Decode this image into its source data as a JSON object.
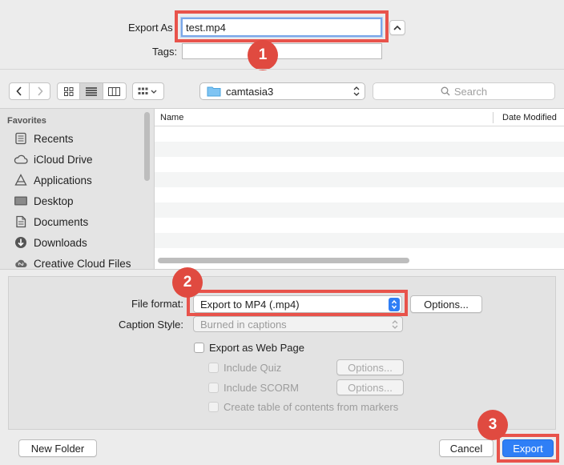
{
  "export_row": {
    "export_as_label": "Export As",
    "filename": "test.mp4",
    "tags_label": "Tags:",
    "tags_value": ""
  },
  "toolbar": {
    "location": "camtasia3",
    "search_placeholder": "Search"
  },
  "sidebar": {
    "heading": "Favorites",
    "items": [
      {
        "label": "Recents",
        "icon": "recents-icon"
      },
      {
        "label": "iCloud Drive",
        "icon": "cloud-icon"
      },
      {
        "label": "Applications",
        "icon": "applications-icon"
      },
      {
        "label": "Desktop",
        "icon": "desktop-icon"
      },
      {
        "label": "Documents",
        "icon": "documents-icon"
      },
      {
        "label": "Downloads",
        "icon": "downloads-icon"
      },
      {
        "label": "Creative Cloud Files",
        "icon": "creative-cloud-icon"
      }
    ]
  },
  "file_list": {
    "columns": [
      "Name",
      "Date Modified"
    ]
  },
  "options_panel": {
    "file_format_label": "File format:",
    "file_format_value": "Export to MP4 (.mp4)",
    "options_button": "Options...",
    "caption_style_label": "Caption Style:",
    "caption_style_value": "Burned in captions",
    "export_web_page": "Export as Web Page",
    "include_quiz": "Include Quiz",
    "include_scorm": "Include SCORM",
    "create_toc": "Create table of contents from markers",
    "quiz_options": "Options...",
    "scorm_options": "Options..."
  },
  "footer": {
    "new_folder": "New Folder",
    "cancel": "Cancel",
    "export": "Export"
  },
  "annotations": {
    "step1": "1",
    "step2": "2",
    "step3": "3"
  },
  "colors": {
    "accent": "#2f7ff6",
    "highlight": "#e8534b"
  }
}
